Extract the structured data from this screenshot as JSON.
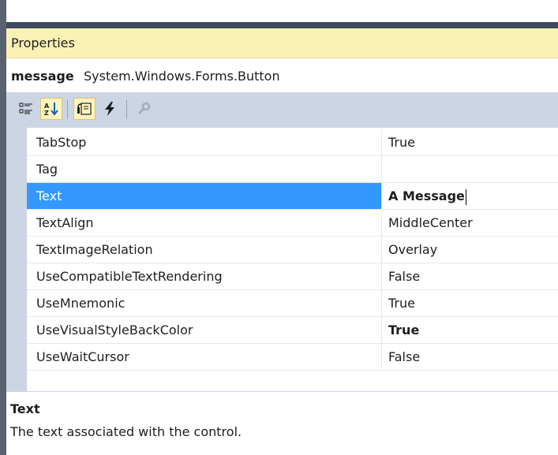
{
  "panel": {
    "title": "Properties"
  },
  "object": {
    "name": "message",
    "type": "System.Windows.Forms.Button"
  },
  "toolbar": {
    "buttons": [
      {
        "icon": "categorized-icon",
        "active": false
      },
      {
        "icon": "alphabetical-icon",
        "active": true
      },
      {
        "icon": "properties-icon",
        "active": true
      },
      {
        "icon": "events-icon",
        "active": false
      },
      {
        "icon": "property-pages-icon",
        "active": false
      }
    ]
  },
  "properties": [
    {
      "name": "TabStop",
      "value": "True",
      "bold": false
    },
    {
      "name": "Tag",
      "value": "",
      "bold": false
    },
    {
      "name": "Text",
      "value": "A Message",
      "bold": true,
      "selected": true
    },
    {
      "name": "TextAlign",
      "value": "MiddleCenter",
      "bold": false
    },
    {
      "name": "TextImageRelation",
      "value": "Overlay",
      "bold": false
    },
    {
      "name": "UseCompatibleTextRendering",
      "value": "False",
      "bold": false
    },
    {
      "name": "UseMnemonic",
      "value": "True",
      "bold": false
    },
    {
      "name": "UseVisualStyleBackColor",
      "value": "True",
      "bold": true
    },
    {
      "name": "UseWaitCursor",
      "value": "False",
      "bold": false
    }
  ],
  "description": {
    "title": "Text",
    "text": "The text associated with the control."
  },
  "colors": {
    "selection": "#3399ff",
    "title_bar": "#fbf1b5",
    "toolbar": "#ccd5e3"
  }
}
